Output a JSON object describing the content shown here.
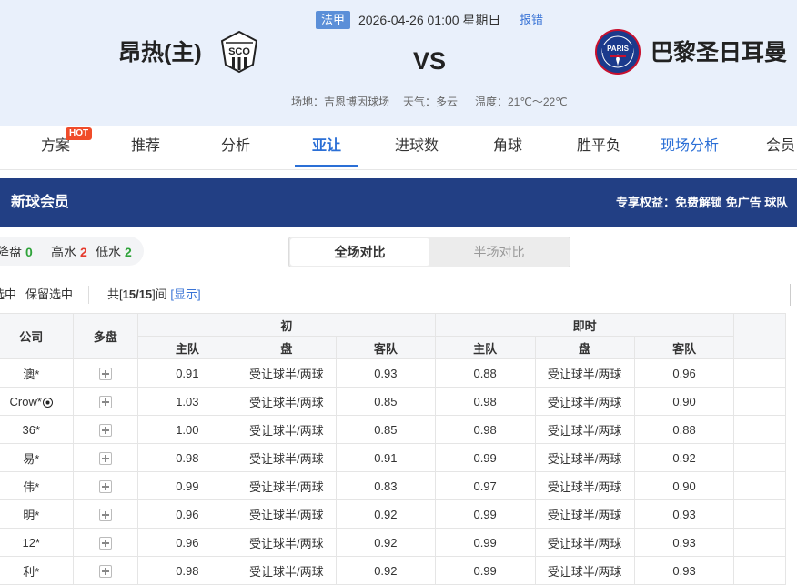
{
  "match": {
    "league": "法甲",
    "datetime": "2026-04-26 01:00 星期日",
    "report": "报错",
    "home_team": "昂热(主)",
    "vs": "VS",
    "away_team": "巴黎圣日耳曼",
    "venue": "场地：吉恩博因球场",
    "weather": "天气：多云",
    "temperature": "温度：21℃～22℃",
    "home_logo_text": "SCO",
    "away_logo_text": "PARIS"
  },
  "tabs": [
    {
      "label": "方案",
      "badge": "HOT"
    },
    {
      "label": "推荐"
    },
    {
      "label": "分析"
    },
    {
      "label": "亚让",
      "active": true
    },
    {
      "label": "进球数"
    },
    {
      "label": "角球"
    },
    {
      "label": "胜平负"
    },
    {
      "label": "现场分析"
    },
    {
      "label": "会员"
    }
  ],
  "vip": {
    "title": "新球会员",
    "benefits": "专享权益：免费解锁 免广告 球队"
  },
  "stats": {
    "drop_label": "降盘",
    "drop_value": "0",
    "high_label": "高水",
    "high_value": "2",
    "low_label": "低水",
    "low_value": "2"
  },
  "segment": {
    "full": "全场对比",
    "half": "半场对比"
  },
  "toolbar": {
    "delete_selected": "选中",
    "keep_selected": "保留选中",
    "count_prefix": "共[",
    "count": "15/15",
    "count_suffix": "]间",
    "show": "[显示]"
  },
  "table": {
    "h_company": "公司",
    "h_multi": "多盘",
    "h_initial": "初",
    "h_live": "即时",
    "h_home": "主队",
    "h_line": "盘",
    "h_away": "客队",
    "rows": [
      {
        "company": "澳*",
        "ih": "0.91",
        "il": "受让球半/两球",
        "ia": "0.93",
        "lh": "0.88",
        "ll": "受让球半/两球",
        "la": "0.96"
      },
      {
        "company": "Crow*",
        "ball": true,
        "ih": "1.03",
        "il": "受让球半/两球",
        "ia": "0.85",
        "lh": "0.98",
        "ll": "受让球半/两球",
        "la": "0.90"
      },
      {
        "company": "36*",
        "ih": "1.00",
        "il": "受让球半/两球",
        "ia": "0.85",
        "lh": "0.98",
        "ll": "受让球半/两球",
        "la": "0.88"
      },
      {
        "company": "易*",
        "ih": "0.98",
        "il": "受让球半/两球",
        "ia": "0.91",
        "lh": "0.99",
        "ll": "受让球半/两球",
        "la": "0.92"
      },
      {
        "company": "伟*",
        "ih": "0.99",
        "il": "受让球半/两球",
        "ia": "0.83",
        "lh": "0.97",
        "ll": "受让球半/两球",
        "la": "0.90"
      },
      {
        "company": "明*",
        "ih": "0.96",
        "il": "受让球半/两球",
        "ia": "0.92",
        "lh": "0.99",
        "ll": "受让球半/两球",
        "la": "0.93"
      },
      {
        "company": "12*",
        "ih": "0.96",
        "il": "受让球半/两球",
        "ia": "0.92",
        "lh": "0.99",
        "ll": "受让球半/两球",
        "la": "0.93"
      },
      {
        "company": "利*",
        "ih": "0.98",
        "il": "受让球半/两球",
        "ia": "0.92",
        "lh": "0.99",
        "ll": "受让球半/两球",
        "la": "0.93"
      }
    ]
  },
  "colors": {
    "accent": "#2b6fd6",
    "header_bg": "#e9f0fb",
    "vip_bg": "#223f84",
    "hot": "#f04c2a",
    "green": "#2fa33a",
    "red": "#e53b2e"
  }
}
